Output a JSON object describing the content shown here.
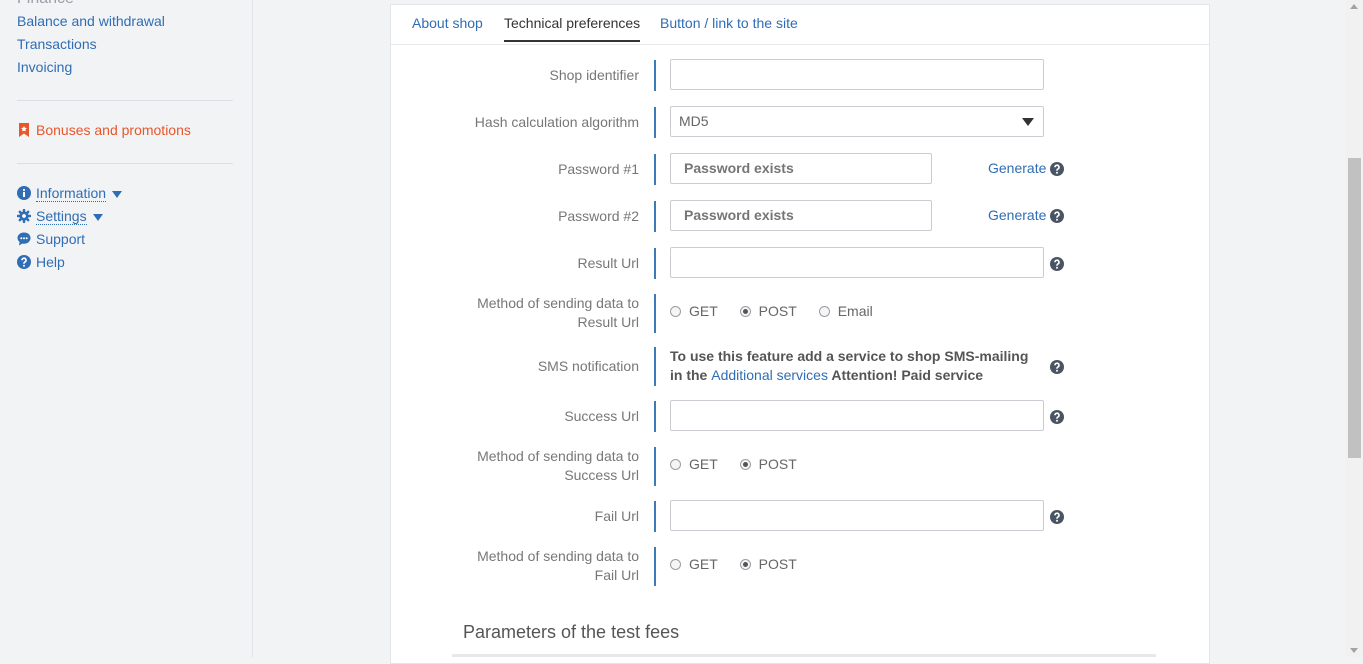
{
  "sidebar": {
    "finance_heading": "Finance",
    "finance_items": [
      "Balance and withdrawal",
      "Transactions",
      "Invoicing"
    ],
    "bonuses": "Bonuses and promotions",
    "information": "Information",
    "settings": "Settings",
    "support": "Support",
    "help": "Help"
  },
  "tabs": [
    "About shop",
    "Technical preferences",
    "Button / link to the site"
  ],
  "form": {
    "shop_identifier_label": "Shop identifier",
    "shop_identifier_value": "",
    "hash_label": "Hash calculation algorithm",
    "hash_value": "MD5",
    "password1_label": "Password #1",
    "password1_placeholder": "Password exists",
    "password2_label": "Password #2",
    "password2_placeholder": "Password exists",
    "generate_label": "Generate",
    "result_url_label": "Result Url",
    "result_url_value": "",
    "result_method_label": "Method of sending data to Result Url",
    "result_method_options": [
      "GET",
      "POST",
      "Email"
    ],
    "result_method_selected": "POST",
    "sms_label": "SMS notification",
    "sms_text_before": "To use this feature add a service to shop SMS-mailing in the",
    "sms_link": "Additional services",
    "sms_text_after": "Attention! Paid service",
    "success_url_label": "Success Url",
    "success_url_value": "",
    "success_method_label": "Method of sending data to Success Url",
    "success_method_options": [
      "GET",
      "POST"
    ],
    "success_method_selected": "POST",
    "fail_url_label": "Fail Url",
    "fail_url_value": "",
    "fail_method_label": "Method of sending data to Fail Url",
    "fail_method_options": [
      "GET",
      "POST"
    ],
    "fail_method_selected": "POST"
  },
  "section": {
    "test_fees_title": "Parameters of the test fees"
  },
  "colors": {
    "link": "#2f6db5",
    "accent_orange": "#e8562a",
    "divider_blue": "#3d7ab8"
  }
}
